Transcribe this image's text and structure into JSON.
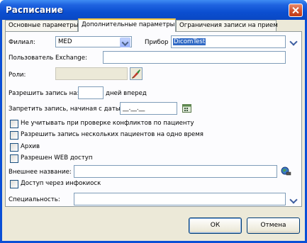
{
  "window": {
    "title": "Расписание"
  },
  "tabs": [
    {
      "label": "Основные параметры"
    },
    {
      "label": "Дополнительные параметры"
    },
    {
      "label": "Ограничения записи на прием"
    }
  ],
  "form": {
    "branch_label": "Филиал:",
    "branch_value": "MED",
    "device_label": "Прибор :",
    "device_value": "DicomTest",
    "exchange_label": "Пользователь Exchange:",
    "exchange_value": "",
    "roles_label": "Роли:",
    "allow_label": "Разрешить запись на:",
    "allow_value": "",
    "allow_suffix": "дней вперед",
    "forbid_label": "Запретить запись, начиная с даты:",
    "forbid_value": "__.__.__",
    "checkboxes": [
      {
        "label": "Не учитывать при проверке конфликтов по пациенту",
        "checked": false
      },
      {
        "label": "Разрешить запись нескольких пациентов на одно время",
        "checked": false
      },
      {
        "label": "Архив",
        "checked": false
      },
      {
        "label": "Разрешен WEB доступ",
        "checked": false
      }
    ],
    "external_name_label": "Внешнее название:",
    "external_name_value": "",
    "kiosk_label": "Доступ через инфокиоск",
    "specialty_label": "Специальность:",
    "specialty_value": ""
  },
  "buttons": {
    "ok": "ОК",
    "cancel": "Отмена"
  },
  "icons": {
    "roles": "brush-icon",
    "date": "calendar-icon",
    "external": "globe-icon"
  }
}
